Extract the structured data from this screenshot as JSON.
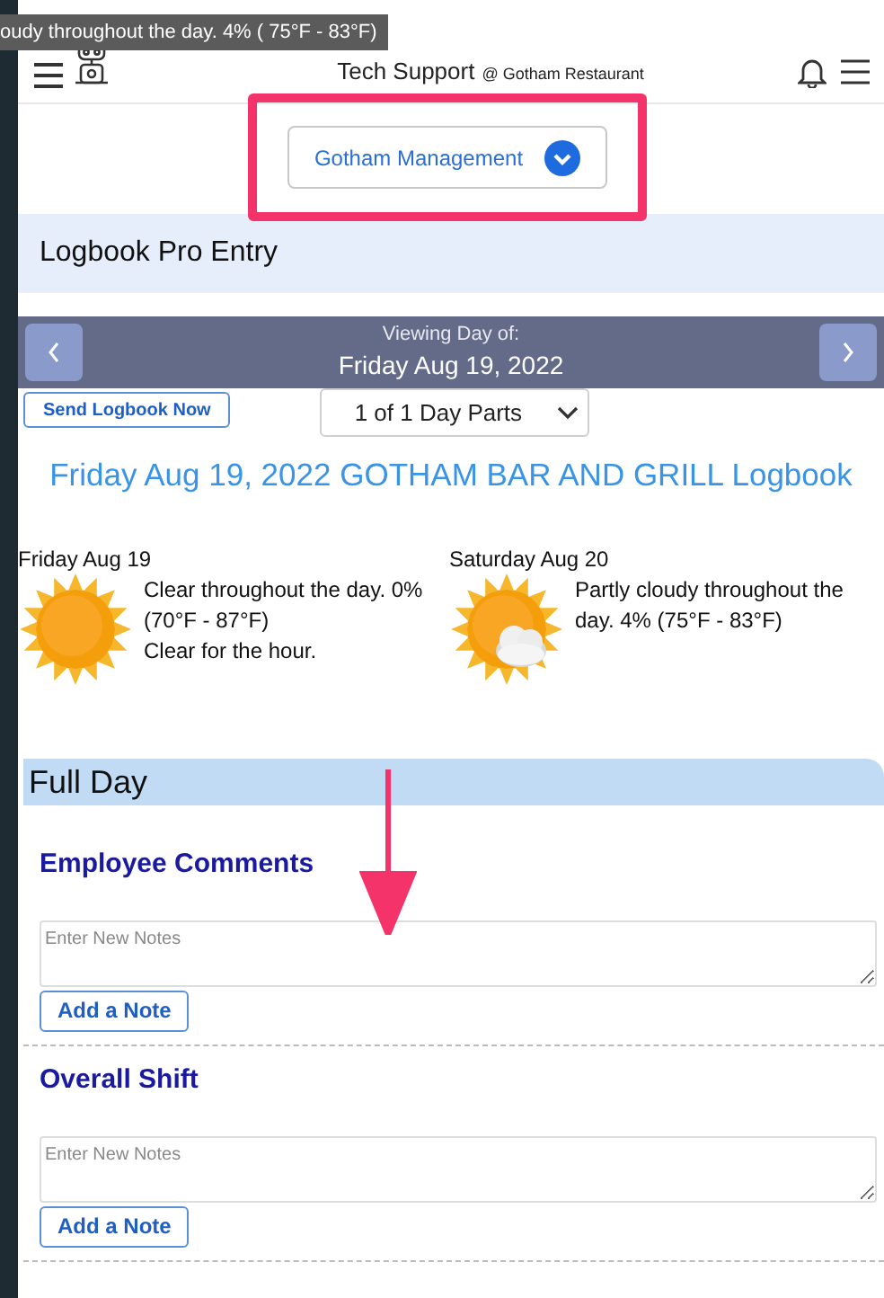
{
  "tooltip": "oudy throughout the day. 4% ( 75°F - 83°F)",
  "header": {
    "user": "Tech Support",
    "location": "@ Gotham Restaurant"
  },
  "management_dropdown": "Gotham Management",
  "section_title": "Logbook Pro Entry",
  "date_bar": {
    "label": "Viewing Day of:",
    "date": "Friday Aug 19, 2022"
  },
  "send_button": "Send Logbook Now",
  "day_parts": "1 of 1 Day Parts",
  "logbook_title": "Friday Aug 19, 2022 GOTHAM BAR AND GRILL Logbook",
  "weather": [
    {
      "kind": "sunny",
      "day": "Friday Aug 19",
      "summary": "Clear throughout the day. 0% (70°F - 87°F)",
      "hourly": "Clear for the hour."
    },
    {
      "kind": "partly_cloudy",
      "day": "Saturday Aug 20",
      "summary": "Partly cloudy throughout the day. 4% (75°F - 83°F)"
    }
  ],
  "day_part": "Full Day",
  "note_sections": [
    {
      "title": "Employee Comments",
      "placeholder": "Enter New Notes",
      "button": "Add a Note"
    },
    {
      "title": "Overall Shift",
      "placeholder": "Enter New Notes",
      "button": "Add a Note"
    }
  ]
}
